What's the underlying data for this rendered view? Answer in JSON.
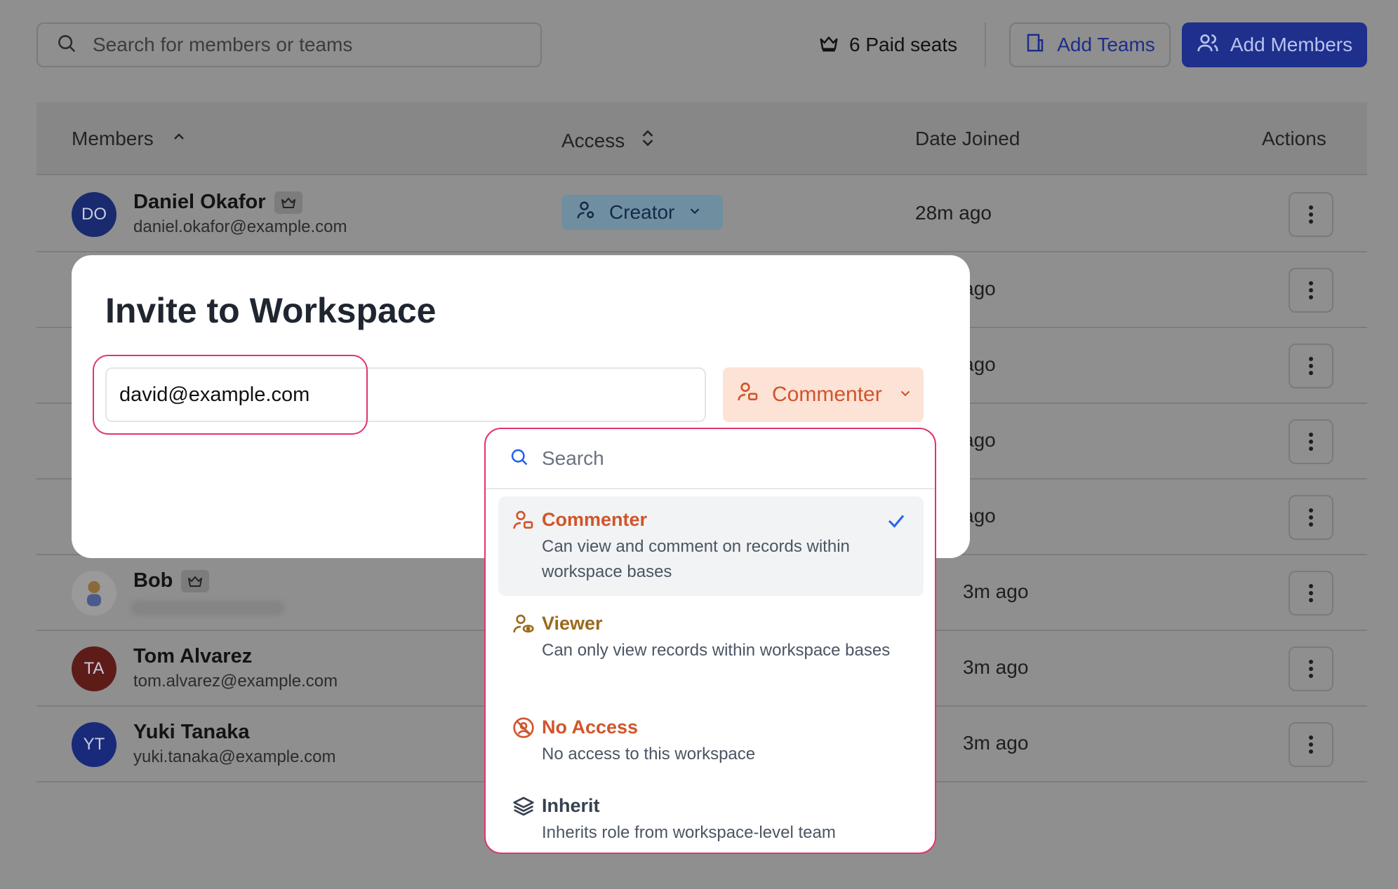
{
  "toolbar": {
    "search_placeholder": "Search for members or teams",
    "seats_label": "6 Paid seats",
    "add_teams_label": "Add Teams",
    "add_members_label": "Add Members"
  },
  "table": {
    "columns": {
      "members": "Members",
      "access": "Access",
      "date_joined": "Date Joined",
      "actions": "Actions"
    },
    "rows": [
      {
        "initials": "DO",
        "name": "Daniel Okafor",
        "email": "daniel.okafor@example.com",
        "access": "Creator",
        "date": "28m ago",
        "avatar_color": "#1a2a6e",
        "owner": true
      },
      {
        "date": "ago"
      },
      {
        "date": "ago"
      },
      {
        "date": "ago"
      },
      {
        "date": "ago"
      },
      {
        "initials": "",
        "name": "Bob",
        "email": "",
        "date": "3m ago",
        "avatar_color": "#9a9a9a",
        "owner": true
      },
      {
        "initials": "TA",
        "name": "Tom Alvarez",
        "email": "tom.alvarez@example.com",
        "date": "3m ago",
        "avatar_color": "#5e1c18"
      },
      {
        "initials": "YT",
        "name": "Yuki Tanaka",
        "email": "yuki.tanaka@example.com",
        "date": "3m ago",
        "avatar_color": "#1a2a7a"
      }
    ]
  },
  "modal": {
    "title": "Invite to Workspace",
    "email_value": "david@example.com",
    "role_selected": "Commenter"
  },
  "dropdown": {
    "search_placeholder": "Search",
    "options": [
      {
        "title": "Commenter",
        "description": "Can view and comment on records within workspace bases",
        "color": "#d0552b",
        "icon": "commenter-icon",
        "selected": true
      },
      {
        "title": "Viewer",
        "description": "Can only view records within workspace bases",
        "color": "#9a6a1c",
        "icon": "viewer-icon"
      },
      {
        "title": "No Access",
        "description": "No access to this workspace",
        "color": "#d0552b",
        "icon": "no-access-icon"
      },
      {
        "title": "Inherit",
        "description": "Inherits role from workspace-level team",
        "color": "#374151",
        "icon": "layers-icon"
      }
    ]
  }
}
